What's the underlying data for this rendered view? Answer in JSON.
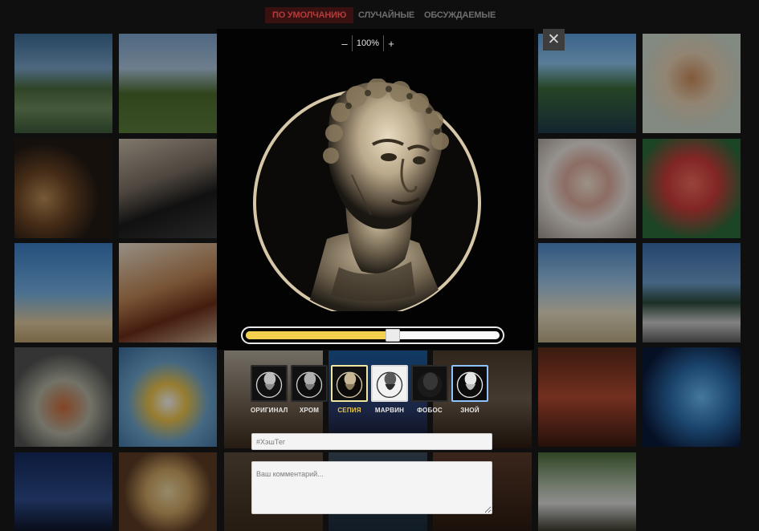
{
  "tabs": [
    {
      "label": "ПО УМОЛЧАНИЮ",
      "active": true
    },
    {
      "label": "СЛУЧАЙНЫЕ",
      "active": false
    },
    {
      "label": "ОБСУЖДАЕМЫЕ",
      "active": false
    }
  ],
  "zoom": {
    "minus": "–",
    "value": "100%",
    "plus": "+"
  },
  "close_label": "✕",
  "slider": {
    "value_percent": 58
  },
  "filters": [
    {
      "name": "ОРИГИНАЛ",
      "selected": false
    },
    {
      "name": "ХРОМ",
      "selected": false
    },
    {
      "name": "СЕПИЯ",
      "selected": true
    },
    {
      "name": "МАРВИН",
      "selected": false
    },
    {
      "name": "ФОБОС",
      "selected": false
    },
    {
      "name": "ЗНОЙ",
      "selected": false
    }
  ],
  "hashtag": {
    "placeholder": "#ХэшТег"
  },
  "comment": {
    "placeholder": "Ваш комментарий..."
  },
  "colors": {
    "accent_yellow": "#f2d04e",
    "active_tab_bg": "#3a1111",
    "active_tab_text": "#b33b3b",
    "selected_filter_border": "#f0e6a0",
    "znoy_border": "#8ec3ff"
  },
  "icons": [
    "close-icon",
    "zoom-minus-icon",
    "zoom-plus-icon",
    "resize-handle-icon"
  ]
}
